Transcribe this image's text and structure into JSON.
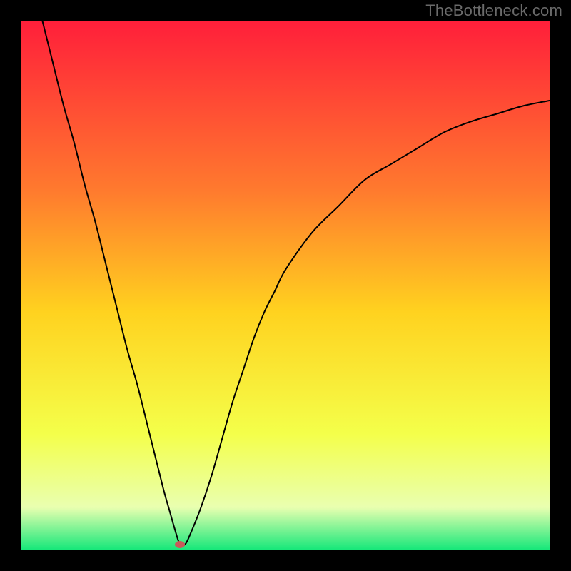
{
  "watermark": {
    "text": "TheBottleneck.com"
  },
  "colors": {
    "top": "#ff1f3a",
    "mid_upper": "#ff7a2e",
    "mid": "#ffd21f",
    "mid_lower": "#f4ff4a",
    "low": "#e9ffb0",
    "base": "#17e87a",
    "curve": "#000000",
    "frame": "#000000",
    "marker": "#c85a5a"
  },
  "chart_data": {
    "type": "line",
    "title": "",
    "xlabel": "",
    "ylabel": "",
    "xlim": [
      0,
      100
    ],
    "ylim": [
      0,
      100
    ],
    "grid": false,
    "legend": false,
    "annotations": [],
    "marker": {
      "x": 30,
      "y": 1
    },
    "series": [
      {
        "name": "bottleneck-curve",
        "x": [
          4,
          6,
          8,
          10,
          12,
          14,
          16,
          18,
          20,
          22,
          24,
          26,
          27,
          28,
          29,
          30,
          31,
          32,
          34,
          36,
          38,
          40,
          42,
          44,
          46,
          48,
          50,
          55,
          60,
          65,
          70,
          75,
          80,
          85,
          90,
          95,
          100
        ],
        "y": [
          100,
          92,
          84,
          77,
          69,
          62,
          54,
          46,
          38,
          31,
          23,
          15,
          11,
          7.5,
          4,
          1,
          1,
          3,
          8,
          14,
          21,
          28,
          34,
          40,
          45,
          49,
          53,
          60,
          65,
          70,
          73,
          76,
          79,
          81,
          82.5,
          84,
          85
        ]
      }
    ]
  }
}
